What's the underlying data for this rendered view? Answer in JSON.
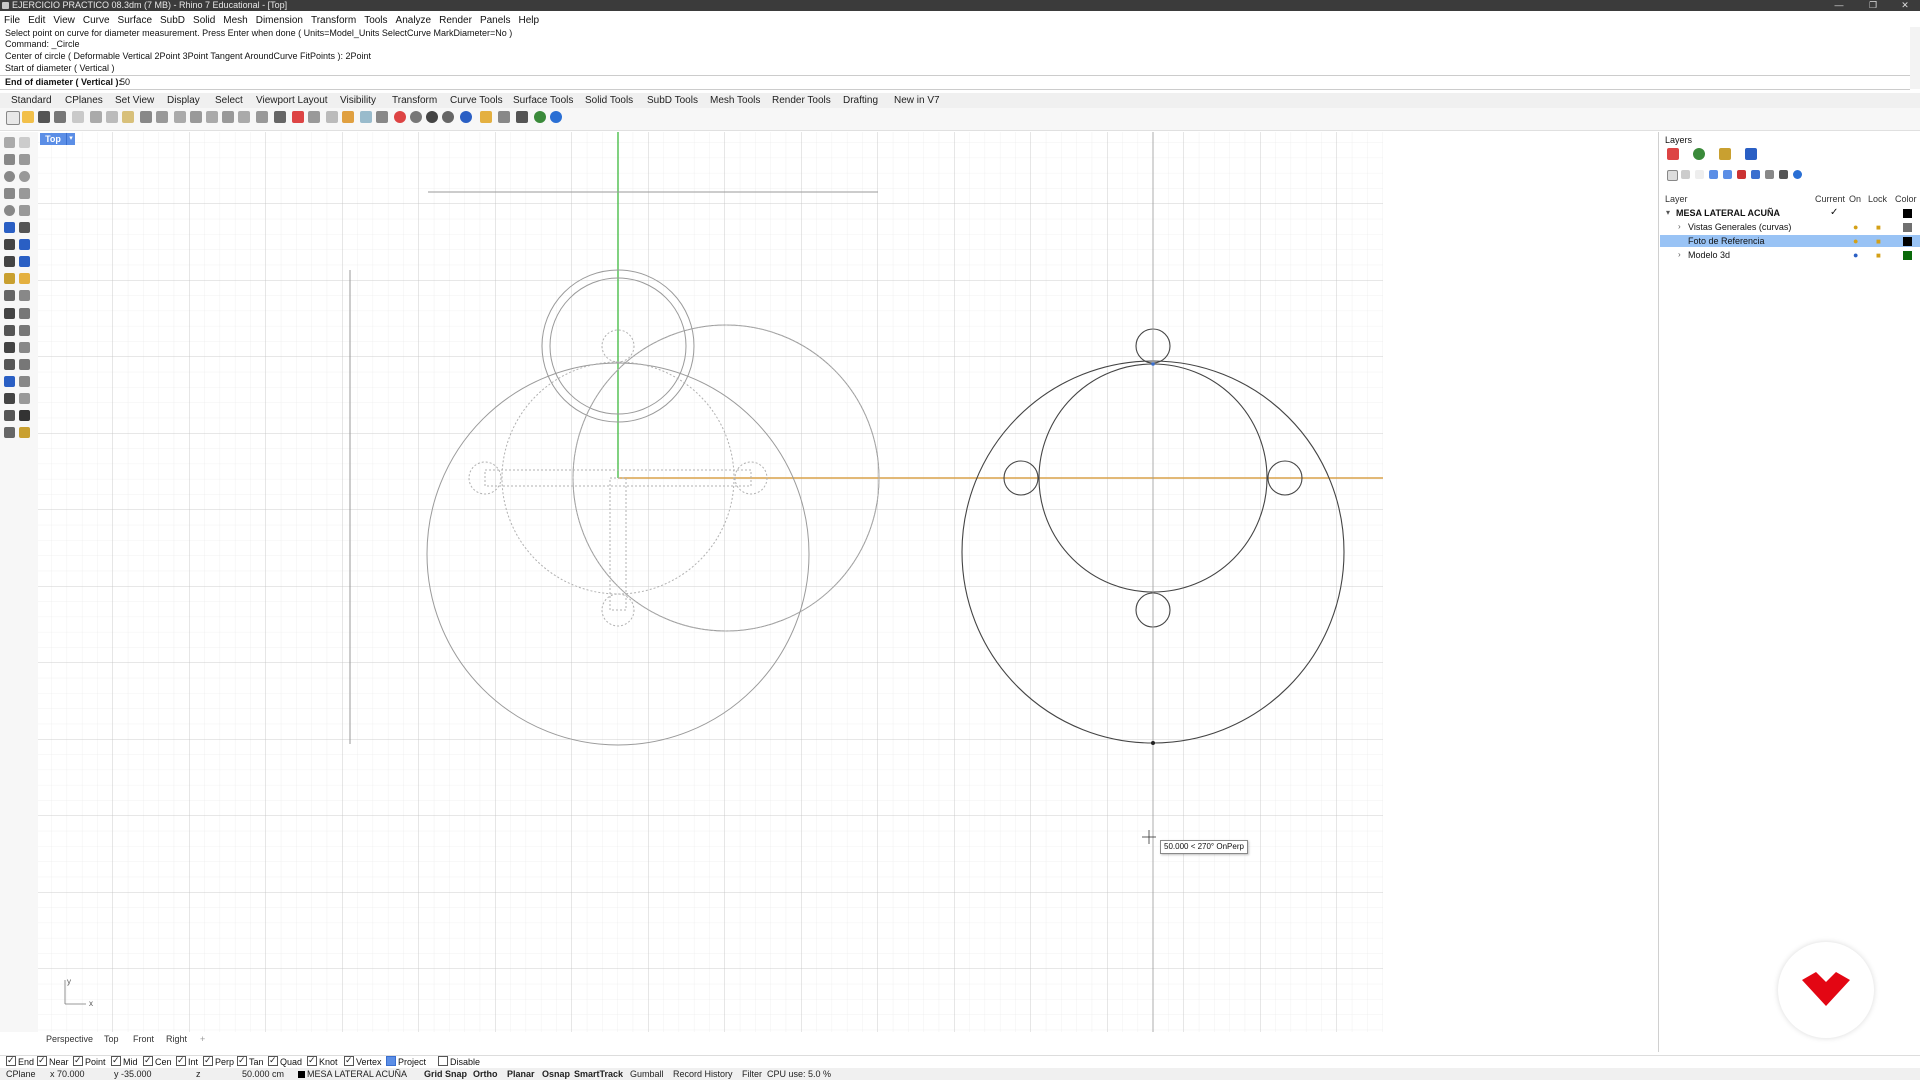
{
  "window": {
    "title": "EJERCICIO PRACTICO 08.3dm (7 MB) - Rhino 7 Educational - [Top]"
  },
  "menu": [
    "File",
    "Edit",
    "View",
    "Curve",
    "Surface",
    "SubD",
    "Solid",
    "Mesh",
    "Dimension",
    "Transform",
    "Tools",
    "Analyze",
    "Render",
    "Panels",
    "Help"
  ],
  "command_history": [
    "Select point on curve for diameter measurement. Press Enter when done ( Units=Model_Units  SelectCurve  MarkDiameter=No )",
    "Command: _Circle",
    "Center of circle ( Deformable  Vertical  2Point  3Point  Tangent  AroundCurve  FitPoints ): 2Point",
    "Start of diameter ( Vertical )"
  ],
  "prompt": {
    "label": "End of diameter ( Vertical ):",
    "value": "50"
  },
  "toolbar_tabs": [
    "Standard",
    "CPlanes",
    "Set View",
    "Display",
    "Select",
    "Viewport Layout",
    "Visibility",
    "Transform",
    "Curve Tools",
    "Surface Tools",
    "Solid Tools",
    "SubD Tools",
    "Mesh Tools",
    "Render Tools",
    "Drafting",
    "New in V7"
  ],
  "viewport": {
    "name": "Top",
    "axis_x": "x",
    "axis_y": "y",
    "tooltip": "50.000 < 270° OnPerp"
  },
  "layers": {
    "title": "Layers",
    "columns": {
      "layer": "Layer",
      "current": "Current",
      "on": "On",
      "lock": "Lock",
      "color": "Color"
    },
    "rows": [
      {
        "name": "MESA LATERAL ACUÑA",
        "current": "✓",
        "color": "#000000",
        "bold": true,
        "indent": 0
      },
      {
        "name": "Vistas Generales (curvas)",
        "color": "#707070",
        "indent": 1
      },
      {
        "name": "Foto de Referencia",
        "color": "#000000",
        "indent": 1,
        "selected": true
      },
      {
        "name": "Modelo 3d",
        "color": "#0a6a0a",
        "indent": 1
      }
    ]
  },
  "view_tabs": [
    "Perspective",
    "Top",
    "Front",
    "Right"
  ],
  "osnaps": [
    {
      "label": "End",
      "checked": true
    },
    {
      "label": "Near",
      "checked": true
    },
    {
      "label": "Point",
      "checked": true
    },
    {
      "label": "Mid",
      "checked": true
    },
    {
      "label": "Cen",
      "checked": true
    },
    {
      "label": "Int",
      "checked": true
    },
    {
      "label": "Perp",
      "checked": true
    },
    {
      "label": "Tan",
      "checked": true
    },
    {
      "label": "Quad",
      "checked": true
    },
    {
      "label": "Knot",
      "checked": true
    },
    {
      "label": "Vertex",
      "checked": true
    },
    {
      "label": "Project",
      "checked": true,
      "filled": true
    },
    {
      "label": "Disable",
      "checked": false
    }
  ],
  "status": {
    "cplane": "CPlane",
    "x": "x 70.000",
    "y": "y -35.000",
    "z": "z",
    "distance": "50.000 cm",
    "layer": "MESA LATERAL ACUÑA",
    "grid_snap": "Grid Snap",
    "ortho": "Ortho",
    "planar": "Planar",
    "osnap": "Osnap",
    "smarttrack": "SmartTrack",
    "gumball": "Gumball",
    "record_history": "Record History",
    "filter": "Filter",
    "cpu": "CPU use: 5.0 %"
  },
  "colors": {
    "x_axis": "#d9a24a",
    "y_axis": "#4cbf4c",
    "selection": "#99c3f5",
    "logo": "#e30613"
  }
}
